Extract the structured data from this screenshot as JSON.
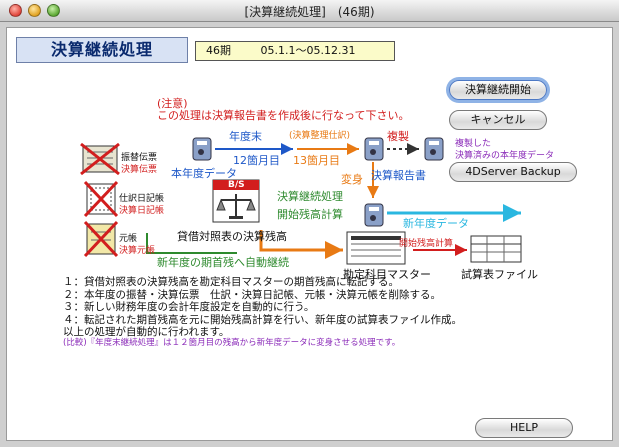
{
  "window": {
    "title": "[決算継続処理]　(46期)"
  },
  "heading": "決算継続処理",
  "period": {
    "term": "46期",
    "range": "05.1.1～05.12.31"
  },
  "buttons": {
    "start": "決算継続開始",
    "cancel": "キャンセル",
    "backup": "4DServer Backup",
    "help": "HELP"
  },
  "notice": {
    "title": "(注意)",
    "text": "この処理は決算報告書を作成後に行なって下さい。"
  },
  "diagram": {
    "year_end": "年度末",
    "month12": "12箇月目",
    "settlement_adj": "(決算整理仕訳)",
    "month13": "13箇月目",
    "copy": "複製",
    "copied_note_1": "複製した",
    "copied_note_2": "決算済みの本年度データ",
    "this_year_data": "本年度データ",
    "transform": "変身",
    "report": "決算報告書",
    "continue_proc": "決算継続処理",
    "opening_calc": "開始残高計算",
    "new_year_data": "新年度データ",
    "transfer_slip_1": "振替伝票",
    "transfer_slip_2": "決算伝票",
    "journal_1": "仕訳日記帳",
    "journal_2": "決算日記帳",
    "ledger_1": "元帳",
    "ledger_2": "決算元帳",
    "bs_balance": "貸借対照表の決算残高",
    "bs_icon": "B/S",
    "auto_continue": "新年度の期首残へ自動継続",
    "opening_calc_small": "開始残高計算",
    "account_master": "勘定科目マスター",
    "trial_file": "試算表ファイル"
  },
  "notes": [
    "１：貸借対照表の決算残高を勘定科目マスターの期首残高に転記する。",
    "２：本年度の振替・決算伝票　仕訳・決算日記帳、元帳・決算元帳を削除する。",
    "３：新しい財務年度の会計年度設定を自動的に行う。",
    "４：転記された期首残高を元に開始残高計算を行い、新年度の試算表ファイル作成。",
    "以上の処理が自動的に行われます。"
  ],
  "footnote": "(比較)『年度末継続処理』は１２箇月目の残高から新年度データに変身させる処理です。",
  "colors": {
    "blue": "#1e58c8",
    "orange": "#e87a14",
    "green": "#2e8a2e",
    "cyan": "#2ab7e0",
    "red": "#d21e1e",
    "purple": "#8a2ab8",
    "heading_bg": "#d8e2f4",
    "period_bg": "#fbfbc9"
  }
}
